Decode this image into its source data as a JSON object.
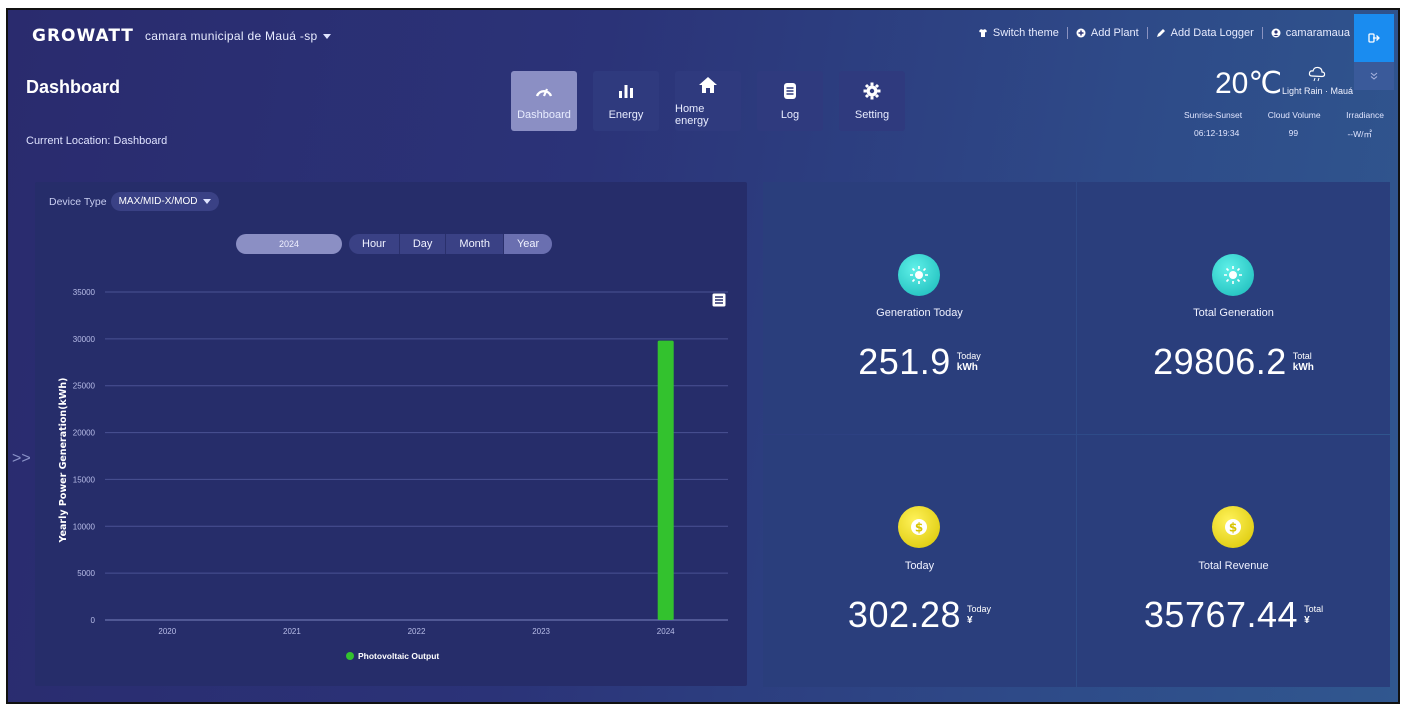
{
  "header": {
    "logo": "GROWATT",
    "plant_name": "camara municipal de Mauá -sp",
    "actions": {
      "switch_theme": "Switch theme",
      "add_plant": "Add Plant",
      "add_data_logger": "Add Data Logger",
      "user": "camaramaua"
    }
  },
  "page": {
    "title": "Dashboard",
    "location": "Current Location: Dashboard"
  },
  "nav": {
    "items": [
      {
        "label": "Dashboard",
        "icon": "gauge-icon",
        "active": true
      },
      {
        "label": "Energy",
        "icon": "bar-chart-icon",
        "active": false
      },
      {
        "label": "Home energy",
        "icon": "home-icon",
        "active": false
      },
      {
        "label": "Log",
        "icon": "log-icon",
        "active": false
      },
      {
        "label": "Setting",
        "icon": "gear-icon",
        "active": false
      }
    ]
  },
  "weather": {
    "temperature": "20℃",
    "description": "Light Rain · Mauá",
    "labels": [
      "Sunrise-Sunset",
      "Cloud Volume",
      "Irradiance"
    ],
    "values": [
      "06:12-19:34",
      "99",
      "--W/㎡"
    ]
  },
  "chart_panel": {
    "device_type_label": "Device Type",
    "device_type_value": "MAX/MID-X/MOD",
    "year": "2024",
    "ranges": [
      "Hour",
      "Day",
      "Month",
      "Year"
    ],
    "active_range": "Year"
  },
  "chart_data": {
    "type": "bar",
    "categories": [
      "2020",
      "2021",
      "2022",
      "2023",
      "2024"
    ],
    "series": [
      {
        "name": "Photovoltaic Output",
        "values": [
          0,
          0,
          0,
          0,
          29806.2
        ],
        "color": "#33c22e"
      }
    ],
    "ylabel": "Yearly Power Generation(kWh)",
    "ylim": [
      0,
      35000
    ],
    "yticks": [
      0,
      5000,
      10000,
      15000,
      20000,
      25000,
      30000,
      35000
    ],
    "grid": true,
    "legend_position": "bottom"
  },
  "stats": {
    "generation_today": {
      "label": "Generation Today",
      "value": "251.9",
      "period": "Today",
      "unit": "kWh"
    },
    "total_generation": {
      "label": "Total Generation",
      "value": "29806.2",
      "period": "Total",
      "unit": "kWh"
    },
    "revenue_today": {
      "label": "Today",
      "value": "302.28",
      "period": "Today",
      "unit": "¥"
    },
    "total_revenue": {
      "label": "Total Revenue",
      "value": "35767.44",
      "period": "Total",
      "unit": "¥"
    }
  },
  "colors": {
    "accent": "#1a8cf0",
    "teal_icon": "#2fd6d0",
    "gold_icon": "#f0e020",
    "bar": "#33c22e"
  }
}
